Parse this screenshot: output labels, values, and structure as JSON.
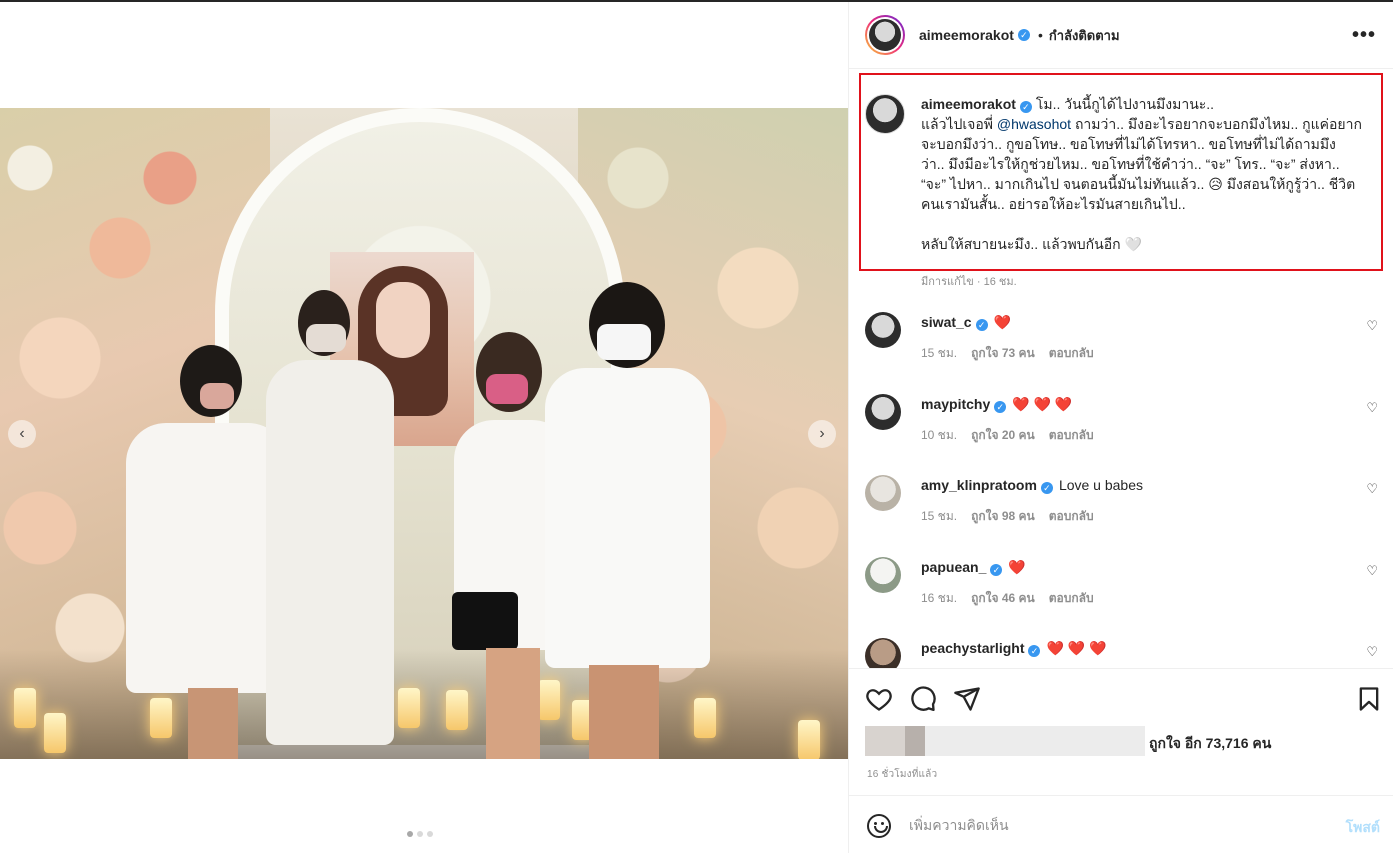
{
  "post": {
    "author": "aimeemorakot",
    "follow_status": "กำลังติดตาม",
    "more_icon": "more-horizontal-icon",
    "caption_lines": [
      "โม.. วันนี้กูได้ไปงานมึงมานะ..",
      "แล้วไปเจอพี่ ",
      " ถามว่า.. มึงอะไรอยากจะบอกมึงไหม.. กูแค่อยาก",
      "จะบอกมึงว่า.. กูขอโทษ.. ขอโทษที่ไม่ได้โทรหา.. ขอโทษที่ไม่ได้ถามมึง",
      "ว่า.. มึงมีอะไรให้กูช่วยไหม.. ขอโทษที่ใช้คำว่า.. “จะ” โทร.. “จะ” ส่งหา..",
      "“จะ” ไปหา.. มากเกินไป จนตอนนี้มันไม่ทันแล้ว.. 😥 มึงสอนให้กูรู้ว่า.. ชีวิต",
      "คนเรามันสั้น.. อย่ารอให้อะไรมันสายเกินไป..",
      "",
      "หลับให้สบายนะมึง.. แล้วพบกันอีก 🤍"
    ],
    "mention": "@hwasohot",
    "edited_label": "มีการแก้ไข · 16 ชม.",
    "likes_text": "ถูกใจ อีก 73,716 คน",
    "time_ago": "16 ชั่วโมงที่แล้ว"
  },
  "comments": [
    {
      "user": "siwat_c",
      "text": "❤️",
      "time": "15 ชม.",
      "likes": "ถูกใจ 73 คน",
      "reply": "ตอบกลับ"
    },
    {
      "user": "maypitchy",
      "text": "❤️ ❤️ ❤️",
      "time": "10 ชม.",
      "likes": "ถูกใจ 20 คน",
      "reply": "ตอบกลับ"
    },
    {
      "user": "amy_klinpratoom",
      "text": "Love u babes",
      "time": "15 ชม.",
      "likes": "ถูกใจ 98 คน",
      "reply": "ตอบกลับ"
    },
    {
      "user": "papuean_",
      "text": "❤️",
      "time": "16 ชม.",
      "likes": "ถูกใจ 46 คน",
      "reply": "ตอบกลับ"
    },
    {
      "user": "peachystarlight",
      "text": "❤️ ❤️ ❤️",
      "time": "",
      "likes": "",
      "reply": ""
    }
  ],
  "add_comment": {
    "placeholder": "เพิ่มความคิดเห็น",
    "post_label": "โพสต์"
  },
  "colors": {
    "highlight_border": "#e0121b",
    "verified": "#3897f0",
    "heart": "#ed4956",
    "post_button_disabled": "#b2dffc"
  }
}
